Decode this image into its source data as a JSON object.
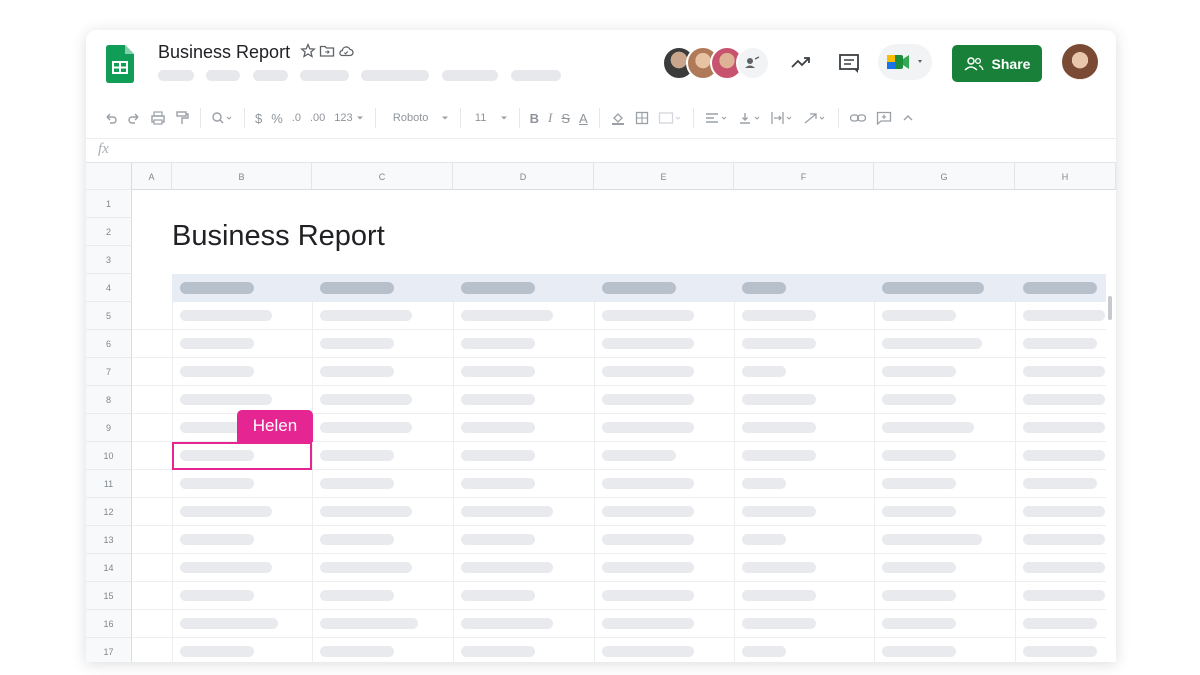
{
  "app": {
    "title": "Business Report",
    "star_icon": "star-icon",
    "move_icon": "folder-move-icon",
    "cloud_icon": "cloud-saved-icon",
    "brand_color": "#188038"
  },
  "header": {
    "activity_icon": "trending-up-icon",
    "comments_icon": "comment-icon",
    "meet_icon": "google-meet-icon",
    "share_label": "Share",
    "share_icon": "people-icon",
    "share_color": "#188038"
  },
  "toolbar": {
    "font_name": "Roboto",
    "font_size": "11",
    "currency": "$",
    "percent": "%",
    "decrease_decimal": ".0",
    "increase_decimal": ".00",
    "number_format": "123",
    "bold": "B",
    "italic": "I",
    "strikethrough": "S",
    "text_color": "A"
  },
  "formula_bar": {
    "fx_label": "fx"
  },
  "sheet": {
    "columns": [
      "A",
      "B",
      "C",
      "D",
      "E",
      "F",
      "G",
      "H"
    ],
    "rows": [
      "1",
      "2",
      "3",
      "4",
      "5",
      "6",
      "7",
      "8",
      "9",
      "10",
      "11",
      "12",
      "13",
      "14",
      "15",
      "16",
      "17"
    ],
    "title": "Business Report"
  },
  "collaborator": {
    "name": "Helen",
    "color": "#e52592",
    "cell": "B10"
  }
}
